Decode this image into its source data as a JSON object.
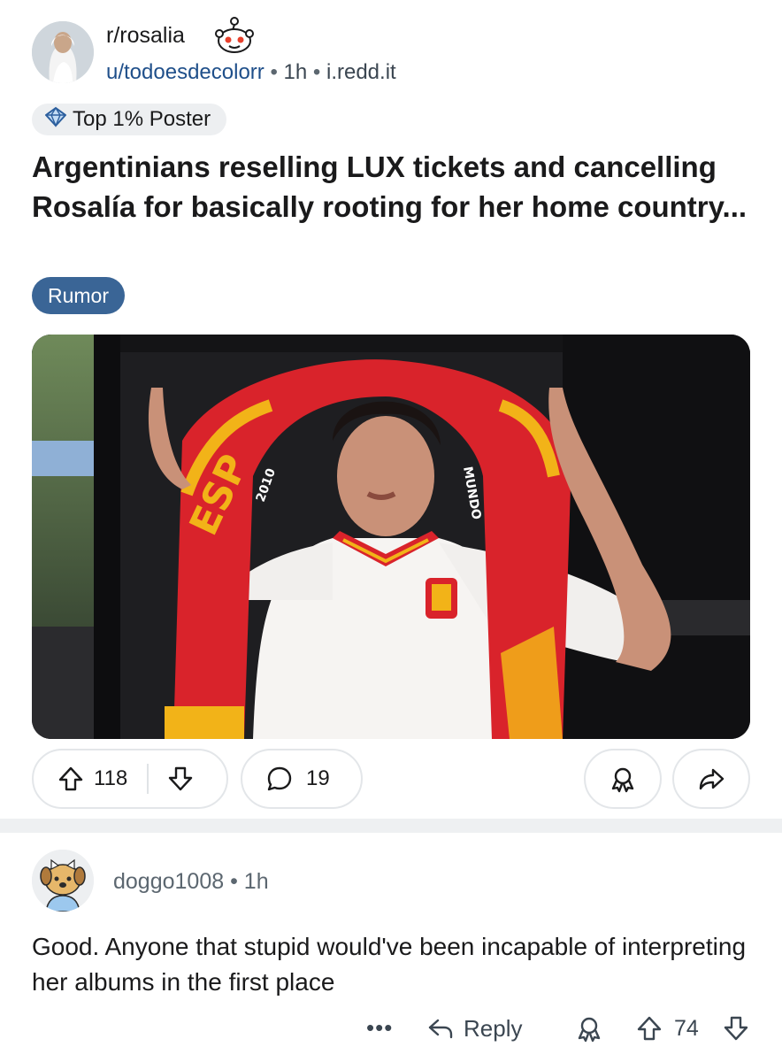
{
  "post": {
    "subreddit": "r/rosalia",
    "author": "u/todoesdecolorr",
    "time": "1h",
    "domain": "i.redd.it",
    "author_flair": "Top 1% Poster",
    "title": "Argentinians reselling LUX tickets and cancelling Rosalía for basically rooting for her home country...",
    "post_flair": "Rumor",
    "score": "118",
    "comment_count": "19",
    "image_text": [
      "ESP",
      "2010",
      "MUNDO"
    ]
  },
  "comment": {
    "author": "doggo1008",
    "time": "1h",
    "body": "Good. Anyone that stupid would've been incapable of interpreting her albums in the first place",
    "more": "•••",
    "reply_label": "Reply",
    "score": "74"
  },
  "colors": {
    "link_blue": "#1f4f8a",
    "flair_bg": "#3a6596",
    "scarf_red": "#d9232b",
    "scarf_yellow": "#f2b318",
    "pill_border": "#e3e6e9"
  },
  "icons": [
    "snoo-icon",
    "badge-icon",
    "upvote-icon",
    "downvote-icon",
    "comment-icon",
    "award-icon",
    "share-icon",
    "reply-icon"
  ]
}
